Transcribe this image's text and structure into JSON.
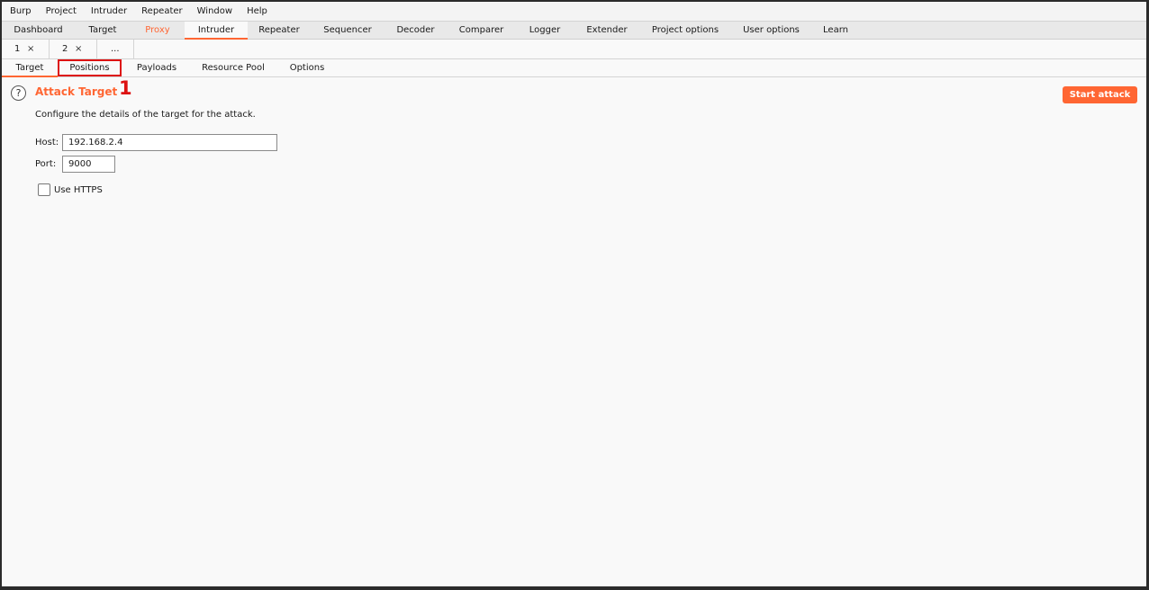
{
  "menu": [
    "Burp",
    "Project",
    "Intruder",
    "Repeater",
    "Window",
    "Help"
  ],
  "main_tabs": [
    "Dashboard",
    "Target",
    "Proxy",
    "Intruder",
    "Repeater",
    "Sequencer",
    "Decoder",
    "Comparer",
    "Logger",
    "Extender",
    "Project options",
    "User options",
    "Learn"
  ],
  "main_tab_active": "Intruder",
  "instance_tabs": [
    {
      "label": "1",
      "close": "×"
    },
    {
      "label": "2",
      "close": "×"
    }
  ],
  "instance_more": "...",
  "sub_tabs": [
    "Target",
    "Positions",
    "Payloads",
    "Resource Pool",
    "Options"
  ],
  "sub_tab_active": "Target",
  "annotation": "1",
  "help_icon": "?",
  "section": {
    "title": "Attack Target",
    "description": "Configure the details of the target for the attack."
  },
  "form": {
    "host_label": "Host:",
    "host_value": "192.168.2.4",
    "port_label": "Port:",
    "port_value": "9000",
    "https_label": "Use HTTPS"
  },
  "start_attack_label": "Start attack",
  "colors": {
    "accent": "#ff6633",
    "annotation": "#dd1111"
  }
}
